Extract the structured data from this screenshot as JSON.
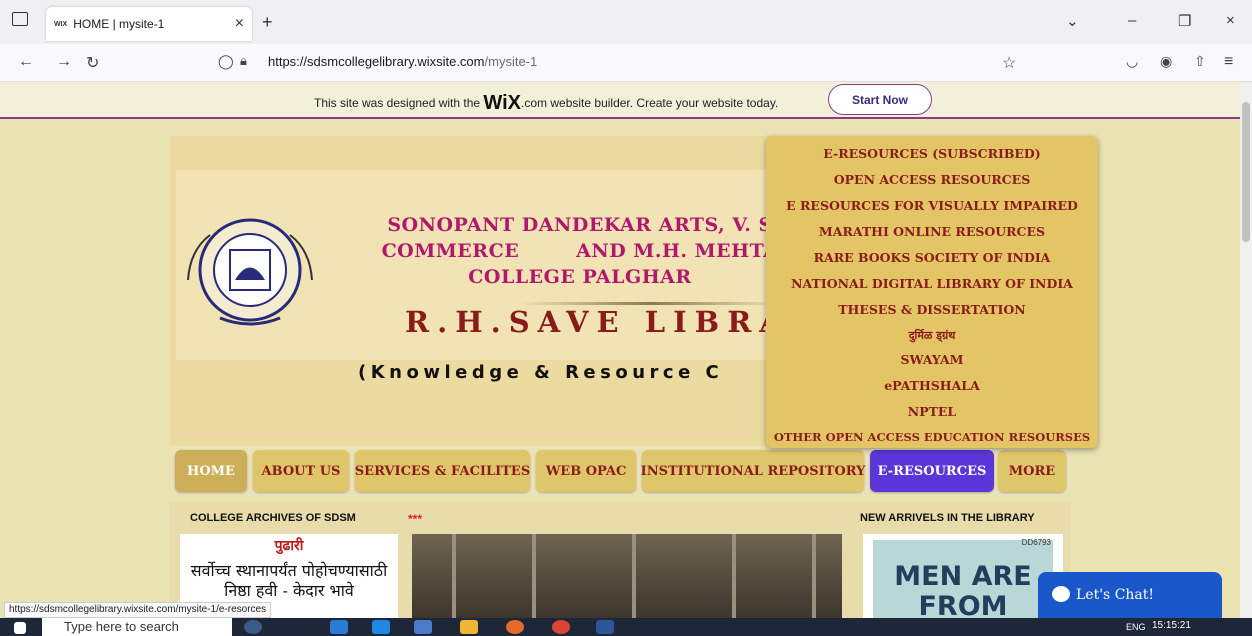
{
  "browser": {
    "tab_title": "HOME | mysite-1",
    "tab_favicon": "WIX",
    "url_host": "https://sdsmcollegelibrary.wixsite.com",
    "url_path": "/mysite-1"
  },
  "wix_banner": {
    "text_before": "This site was designed with the ",
    "brand": "WiX",
    "text_after": ".com website builder. Create your website today.",
    "button": "Start Now"
  },
  "header": {
    "college_line1": "SONOPANT DANDEKAR ARTS, V. S",
    "college_line2": "COMMERCE        AND M.H. MEHTA",
    "college_line3": "COLLEGE PALGHAR",
    "library": "R.H.SAVE LIBRA",
    "tagline": "(Knowledge & Resource C"
  },
  "menu": [
    "HOME",
    "ABOUT US",
    "SERVICES & FACILITES",
    "WEB OPAC",
    "INSTITUTIONAL REPOSITORY",
    "E-RESOURCES",
    "MORE"
  ],
  "dropdown": [
    "E-RESOURCES (SUBSCRIBED)",
    "OPEN ACCESS RESOURCES",
    "E RESOURCES FOR VISUALLY IMPAIRED",
    "MARATHI ONLINE RESOURCES",
    "RARE BOOKS SOCIETY OF INDIA",
    "NATIONAL DIGITAL LIBRARY OF INDIA",
    "THESES & DISSERTATION",
    "दुर्मिळ ड्ग्रंथ",
    "SWAYAM",
    "ePATHSHALA",
    "NPTEL",
    "OTHER OPEN ACCESS EDUCATION RESOURSES"
  ],
  "sections": {
    "archives_title": "COLLEGE ARCHIVES OF  SDSM",
    "stars": "***",
    "new_arrivals_title": "NEW  ARRIVELS IN THE LIBRARY",
    "news_mast": "पुढारी",
    "news_headline1": "सर्वोच्च स्थानापर्यंत पोहोचण्यासाठी",
    "news_headline2": "निष्ठा हवी - केदार भावे",
    "book_cover": "MEN ARE FROM MARS",
    "book_code": "DD6793"
  },
  "chat": {
    "label": "Let's Chat!"
  },
  "status_url": "https://sdsmcollegelibrary.wixsite.com/mysite-1/e-resorces",
  "taskbar": {
    "search": "Type here to search",
    "lang": "ENG",
    "time": "15:15:21"
  }
}
